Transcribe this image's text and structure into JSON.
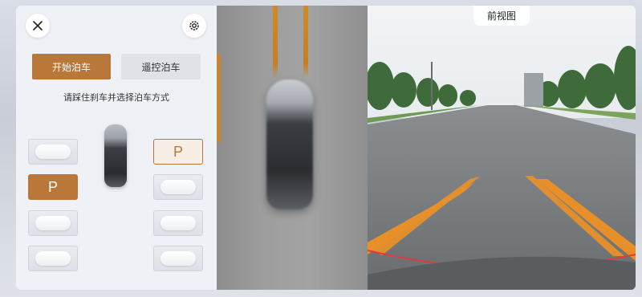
{
  "left_panel": {
    "close_icon": "close-icon",
    "settings_icon": "gear-icon",
    "start_parking": "开始泊车",
    "remote_parking": "遥控泊车",
    "hint": "请踩住刹车并选择泊车方式"
  },
  "slots": {
    "left": [
      {
        "type": "empty"
      },
      {
        "type": "parking",
        "label": "P",
        "style": "filled"
      },
      {
        "type": "empty"
      },
      {
        "type": "empty"
      }
    ],
    "right": [
      {
        "type": "parking",
        "label": "P",
        "style": "outline"
      },
      {
        "type": "empty"
      },
      {
        "type": "empty"
      },
      {
        "type": "empty"
      }
    ]
  },
  "camera": {
    "view_label": "前视图"
  },
  "colors": {
    "accent": "#b9773a",
    "guide_line": "#e7902a",
    "range_line": "#e23b3b"
  }
}
